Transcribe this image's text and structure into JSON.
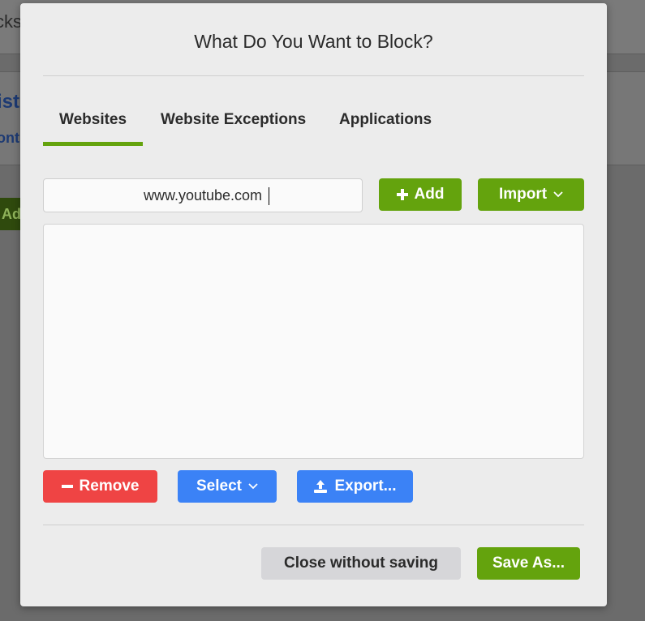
{
  "background": {
    "top_text": "cks",
    "blue_text_1": "ist",
    "blue_text_2": "ont",
    "add_text": "Ad"
  },
  "dialog": {
    "title": "What Do You Want to Block?",
    "tabs": [
      {
        "label": "Websites",
        "active": true
      },
      {
        "label": "Website Exceptions",
        "active": false
      },
      {
        "label": "Applications",
        "active": false
      }
    ],
    "url_input": {
      "value": "www.youtube.com",
      "placeholder": ""
    },
    "add_button": {
      "label": "Add",
      "icon": "plus-icon"
    },
    "import_button": {
      "label": "Import",
      "icon": "chevron-down-icon"
    },
    "website_list": [],
    "remove_button": {
      "label": "Remove",
      "icon": "minus-icon"
    },
    "select_button": {
      "label": "Select",
      "icon": "chevron-down-icon"
    },
    "export_button": {
      "label": "Export...",
      "icon": "upload-icon"
    },
    "close_button": {
      "label": "Close without saving"
    },
    "save_button": {
      "label": "Save As..."
    }
  },
  "colors": {
    "green": "#64a30d",
    "red": "#ef4444",
    "blue": "#3b82f6",
    "gray_button": "#d6d6d9",
    "modal_bg": "#ececec"
  }
}
